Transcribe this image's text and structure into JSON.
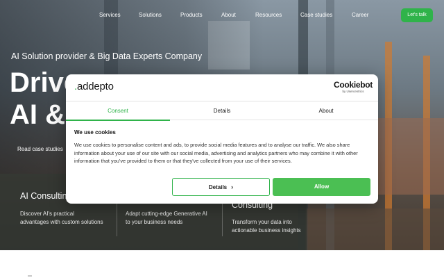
{
  "nav": {
    "items": [
      "Services",
      "Solutions",
      "Products",
      "About",
      "Resources",
      "Case studies",
      "Career"
    ],
    "cta": "Let's talk"
  },
  "hero": {
    "kicker": "AI Solution provider & Big Data Experts Company",
    "headline_line1": "Drive",
    "headline_line2": "AI &",
    "read_case": "Read case studies"
  },
  "cards": [
    {
      "title": "AI Consulting",
      "text": "Discover AI's practical advantages with custom solutions"
    },
    {
      "title": "",
      "text": "Adapt cutting-edge Generative AI to your business needs"
    },
    {
      "title": "Consulting",
      "text": "Transform your data into actionable business insights"
    }
  ],
  "cookie": {
    "brand": "addepto",
    "brand_dot": ".",
    "provider": "Cookiebot",
    "provider_sub": "by Usercentrics",
    "tabs": [
      "Consent",
      "Details",
      "About"
    ],
    "heading": "We use cookies",
    "body": "We use cookies to personalise content and ads, to provide social media features and to analyse our traffic. We also share information about your use of our site with our social media, advertising and analytics partners who may combine it with other information that you've provided to them or that they've collected from your use of their services.",
    "details_button": "Details",
    "allow_button": "Allow"
  },
  "colors": {
    "accent": "#2fb34a",
    "allow": "#4bbf53"
  },
  "icons": {
    "details_chevron": "chevron-right-icon"
  }
}
